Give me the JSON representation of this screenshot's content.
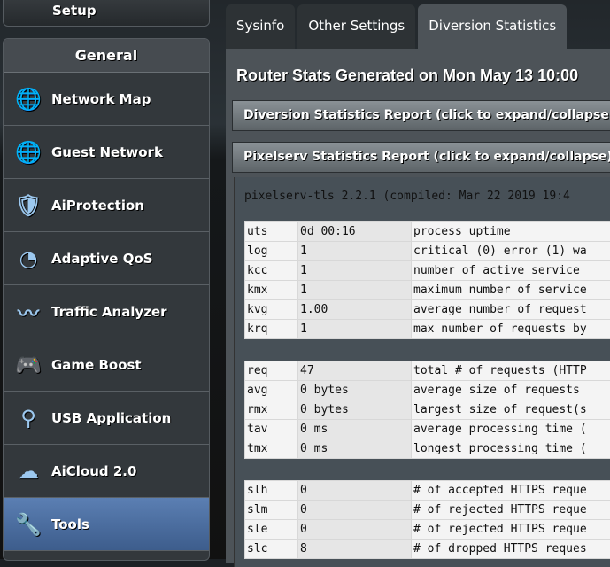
{
  "sidebar": {
    "setup_label": "Setup",
    "section_title": "General",
    "items": [
      {
        "label": "Network Map",
        "icon": "globe-pin-icon"
      },
      {
        "label": "Guest Network",
        "icon": "globe-users-icon"
      },
      {
        "label": "AiProtection",
        "icon": "shield-lock-icon"
      },
      {
        "label": "Adaptive QoS",
        "icon": "speedometer-icon"
      },
      {
        "label": "Traffic Analyzer",
        "icon": "pulse-icon"
      },
      {
        "label": "Game Boost",
        "icon": "gamepad-icon"
      },
      {
        "label": "USB Application",
        "icon": "usb-icon"
      },
      {
        "label": "AiCloud 2.0",
        "icon": "cloud-icon"
      },
      {
        "label": "Tools",
        "icon": "wrench-icon",
        "active": true
      }
    ]
  },
  "tabs": [
    "Sysinfo",
    "Other Settings",
    "Diversion Statistics"
  ],
  "main": {
    "title": "Router Stats Generated on Mon May 13 10:00",
    "diversion_bar": "Diversion Statistics Report (click to expand/collapse)",
    "pixelserv_bar": "Pixelserv Statistics Report (click to expand/collapse)",
    "version": "pixelserv-tls 2.2.1 (compiled: Mar 22 2019 19:4",
    "groups": [
      [
        [
          "uts",
          "0d 00:16",
          "process uptime"
        ],
        [
          "log",
          "1",
          "critical (0) error (1) wa"
        ],
        [
          "kcc",
          "1",
          "number of active service"
        ],
        [
          "kmx",
          "1",
          "maximum number of service"
        ],
        [
          "kvg",
          "1.00",
          "average number of request"
        ],
        [
          "krq",
          "1",
          "max number of requests by"
        ]
      ],
      [
        [
          "req",
          "47",
          "total # of requests (HTTP"
        ],
        [
          "avg",
          "0 bytes",
          "average size of requests"
        ],
        [
          "rmx",
          "0 bytes",
          "largest size of request(s"
        ],
        [
          "tav",
          "0 ms",
          "average processing time ("
        ],
        [
          "tmx",
          "0 ms",
          "longest processing time ("
        ]
      ],
      [
        [
          "slh",
          "0",
          "# of accepted HTTPS reque"
        ],
        [
          "slm",
          "0",
          "# of rejected HTTPS reque"
        ],
        [
          "sle",
          "0",
          "# of rejected HTTPS reque"
        ],
        [
          "slc",
          "8",
          "# of dropped HTTPS reques"
        ]
      ]
    ]
  },
  "colors": {
    "active_item": "#4a6ea3",
    "panel": "#4d5358"
  }
}
